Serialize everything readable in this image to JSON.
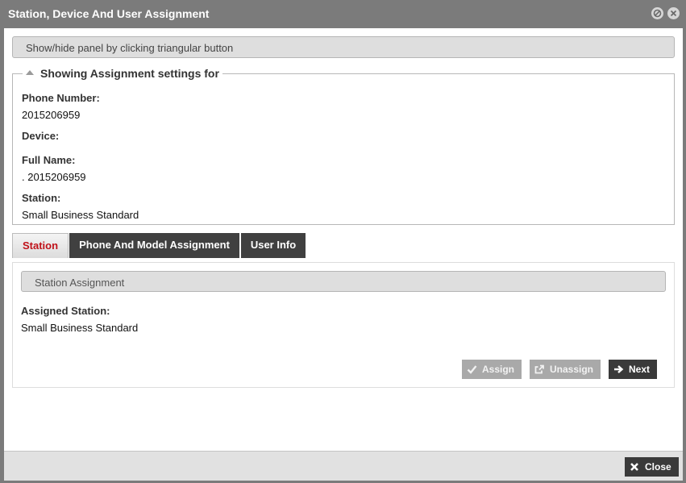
{
  "dialog": {
    "title": "Station, Device And User Assignment",
    "hint": "Show/hide panel by clicking triangular button"
  },
  "info": {
    "legend": "Showing Assignment settings for",
    "phone_label": "Phone Number:",
    "phone_value": "2015206959",
    "device_label": "Device:",
    "device_value": "",
    "fullname_label": "Full Name:",
    "fullname_value": ". 2015206959",
    "station_label": "Station:",
    "station_value": "Small Business Standard"
  },
  "tabs": [
    {
      "label": "Station",
      "active": true
    },
    {
      "label": "Phone And Model Assignment",
      "active": false
    },
    {
      "label": "User Info",
      "active": false
    }
  ],
  "station_panel": {
    "section_title": "Station Assignment",
    "assigned_label": "Assigned Station:",
    "assigned_value": "Small Business Standard",
    "assign_label": "Assign",
    "unassign_label": "Unassign",
    "next_label": "Next"
  },
  "footer": {
    "close_label": "Close"
  },
  "colors": {
    "titlebar": "#7b7b7b",
    "active_tab_text": "#c0121a",
    "dark_button": "#3a3a3a",
    "disabled_button": "#a9a9a9"
  },
  "icons": {
    "minimize": "circle-slash-icon",
    "close_window": "circle-x-icon",
    "collapse": "triangle-up-icon",
    "assign": "checkmark-icon",
    "unassign": "unlink-icon",
    "next": "arrow-right-icon",
    "close": "x-icon"
  }
}
